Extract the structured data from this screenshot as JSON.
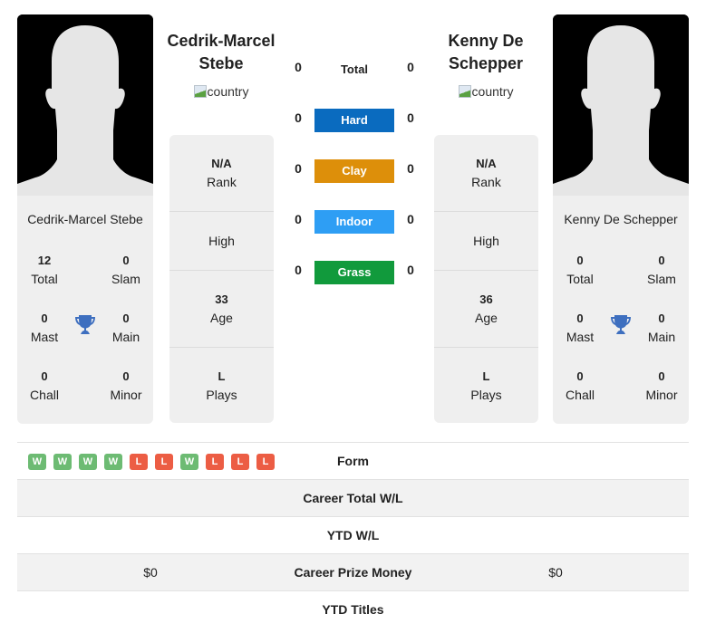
{
  "colors": {
    "hard": "#0a6bbf",
    "clay": "#dd8f0a",
    "indoor": "#2e9ef4",
    "grass": "#119a3c",
    "win": "#6dbb73",
    "loss": "#ec5d44",
    "trophy": "#3e6fbf"
  },
  "player1": {
    "name": "Cedrik-Marcel Stebe",
    "name_line1": "Cedrik-Marcel",
    "name_line2": "Stebe",
    "flag_alt": "country",
    "photo_icon": "silhouette-avatar",
    "titles": {
      "total": {
        "value": "12",
        "label": "Total"
      },
      "slam": {
        "value": "0",
        "label": "Slam"
      },
      "mast": {
        "value": "0",
        "label": "Mast"
      },
      "main": {
        "value": "0",
        "label": "Main"
      },
      "chall": {
        "value": "0",
        "label": "Chall"
      },
      "minor": {
        "value": "0",
        "label": "Minor"
      }
    },
    "info": {
      "rank": {
        "value": "N/A",
        "label": "Rank"
      },
      "high": {
        "value": "",
        "label": "High"
      },
      "age": {
        "value": "33",
        "label": "Age"
      },
      "plays": {
        "value": "L",
        "label": "Plays"
      }
    }
  },
  "player2": {
    "name": "Kenny De Schepper",
    "name_line1": "Kenny De",
    "name_line2": "Schepper",
    "flag_alt": "country",
    "photo_icon": "silhouette-avatar",
    "titles": {
      "total": {
        "value": "0",
        "label": "Total"
      },
      "slam": {
        "value": "0",
        "label": "Slam"
      },
      "mast": {
        "value": "0",
        "label": "Mast"
      },
      "main": {
        "value": "0",
        "label": "Main"
      },
      "chall": {
        "value": "0",
        "label": "Chall"
      },
      "minor": {
        "value": "0",
        "label": "Minor"
      }
    },
    "info": {
      "rank": {
        "value": "N/A",
        "label": "Rank"
      },
      "high": {
        "value": "",
        "label": "High"
      },
      "age": {
        "value": "36",
        "label": "Age"
      },
      "plays": {
        "value": "L",
        "label": "Plays"
      }
    }
  },
  "h2h": {
    "total": {
      "label": "Total",
      "p1": "0",
      "p2": "0"
    },
    "surfaces": [
      {
        "label": "Hard",
        "p1": "0",
        "p2": "0",
        "color": "#0a6bbf"
      },
      {
        "label": "Clay",
        "p1": "0",
        "p2": "0",
        "color": "#dd8f0a"
      },
      {
        "label": "Indoor",
        "p1": "0",
        "p2": "0",
        "color": "#2e9ef4"
      },
      {
        "label": "Grass",
        "p1": "0",
        "p2": "0",
        "color": "#119a3c"
      }
    ]
  },
  "table": {
    "form": {
      "label": "Form",
      "p1": [
        "W",
        "W",
        "W",
        "W",
        "L",
        "L",
        "W",
        "L",
        "L",
        "L"
      ]
    },
    "career_wl": {
      "label": "Career Total W/L",
      "p1": "",
      "p2": ""
    },
    "ytd_wl": {
      "label": "YTD W/L",
      "p1": "",
      "p2": ""
    },
    "prize": {
      "label": "Career Prize Money",
      "p1": "$0",
      "p2": "$0"
    },
    "ytd_titles": {
      "label": "YTD Titles",
      "p1": "",
      "p2": ""
    }
  }
}
